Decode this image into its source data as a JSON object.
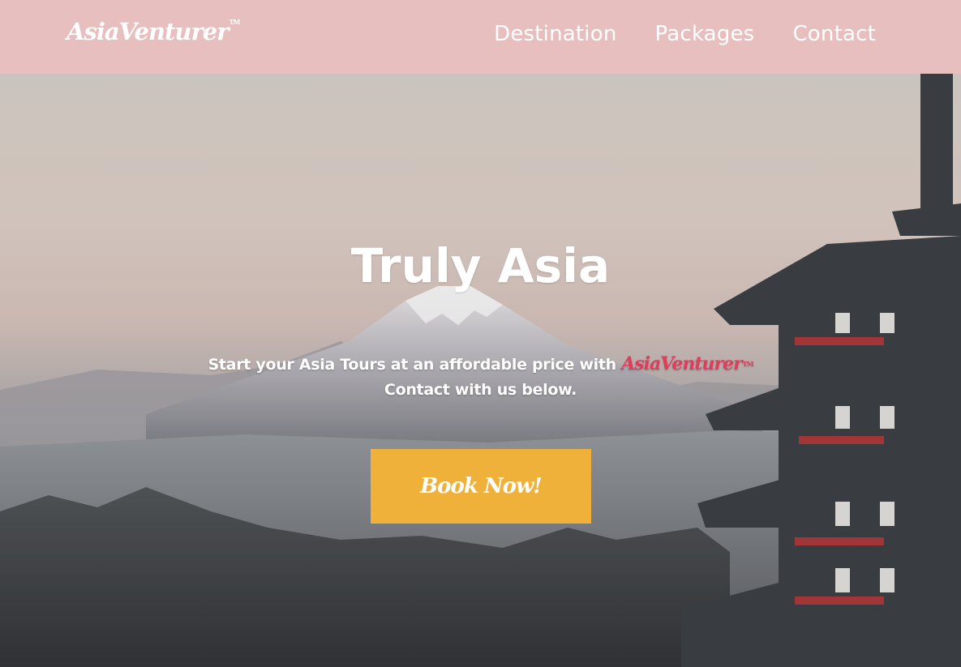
{
  "nav": {
    "brand": "AsiaVenturer",
    "brand_mark": "TM",
    "links": [
      {
        "label": "Destination"
      },
      {
        "label": "Packages"
      },
      {
        "label": "Contact"
      }
    ]
  },
  "hero": {
    "title": "Truly Asia",
    "subtitle_before": "Start your Asia Tours at an affordable price with ",
    "subtitle_brand": "AsiaVenturer",
    "subtitle_brand_mark": "TM",
    "subtitle_line2": "Contact with us below.",
    "cta_label": "Book Now!"
  },
  "colors": {
    "nav_background": "#e8bfbf",
    "accent_brand": "#e03c5c",
    "cta_background": "#f0b13b",
    "text": "#ffffff"
  }
}
